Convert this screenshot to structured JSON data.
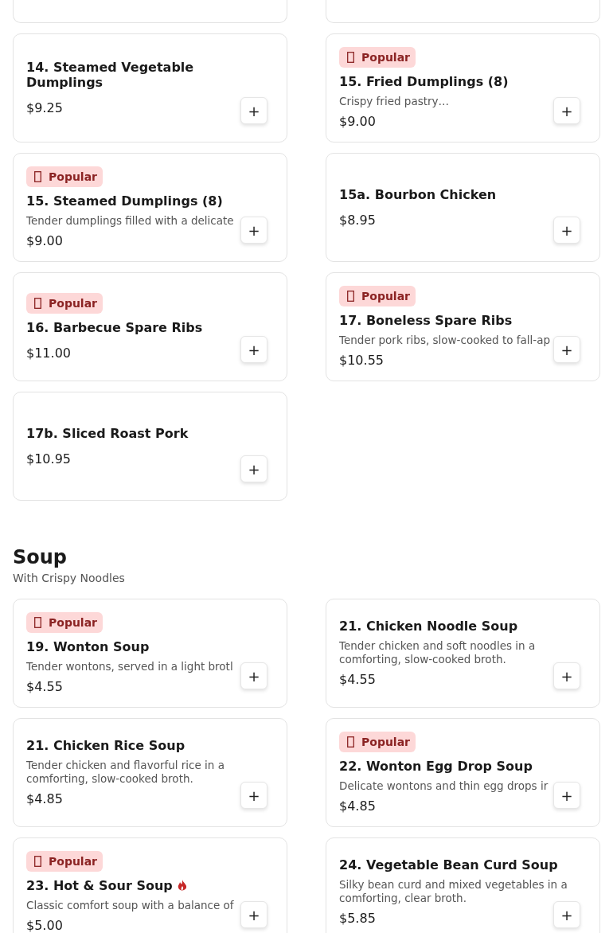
{
  "sections": [
    {
      "items": [
        {
          "name": "14. Steamed Vegetable Dumplings",
          "price": "$9.25",
          "spicy": false,
          "button": "+"
        },
        {
          "badge": "Popular",
          "name": "15. Fried Dumplings (8)",
          "description": "Crispy fried pastry…",
          "price": "$9.00",
          "spicy": false,
          "button": "+"
        },
        {
          "badge": "Popular",
          "name": "15. Steamed Dumplings (8)",
          "description": "Tender dumplings filled with a delicate",
          "price": "$9.00",
          "spicy": false,
          "button": "+"
        },
        {
          "name": "15a. Bourbon Chicken",
          "price": "$8.95",
          "spicy": false,
          "button": "+"
        },
        {
          "badge": "Popular",
          "name": "16. Barbecue Spare Ribs",
          "price": "$11.00",
          "spicy": false,
          "button": "+"
        },
        {
          "badge": "Popular",
          "name": "17. Boneless Spare Ribs",
          "description": "Tender pork ribs, slow-cooked to fall-ap",
          "price": "$10.55",
          "spicy": false,
          "button": "+"
        },
        {
          "name": "17b. Sliced Roast Pork",
          "price": "$10.95",
          "spicy": false,
          "button": "+"
        }
      ]
    },
    {
      "title": "Soup",
      "subtitle": "With Crispy Noodles",
      "items": [
        {
          "badge": "Popular",
          "name": "19. Wonton Soup",
          "description": "Tender wontons, served in a light brotl",
          "price": "$4.55",
          "spicy": false,
          "button": "+"
        },
        {
          "name": "21. Chicken Noodle Soup",
          "description": "Tender chicken and soft noodles in a comforting, slow-cooked broth.",
          "price": "$4.55",
          "spicy": false,
          "button": "+"
        },
        {
          "name": "21. Chicken Rice Soup",
          "description": "Tender chicken and flavorful rice in a comforting, slow-cooked broth.",
          "price": "$4.85",
          "spicy": false,
          "button": "+"
        },
        {
          "badge": "Popular",
          "name": "22. Wonton Egg Drop Soup",
          "description": "Delicate wontons and thin egg drops ir",
          "price": "$4.85",
          "spicy": false,
          "button": "+"
        },
        {
          "badge": "Popular",
          "name": "23. Hot & Sour Soup",
          "description": "Classic comfort soup with a balance of",
          "price": "$5.00",
          "spicy": true,
          "button": "+"
        },
        {
          "name": "24. Vegetable Bean Curd Soup",
          "description": "Silky bean curd and mixed vegetables in a comforting, clear broth.",
          "price": "$5.85",
          "spicy": false,
          "button": "+"
        }
      ]
    }
  ]
}
